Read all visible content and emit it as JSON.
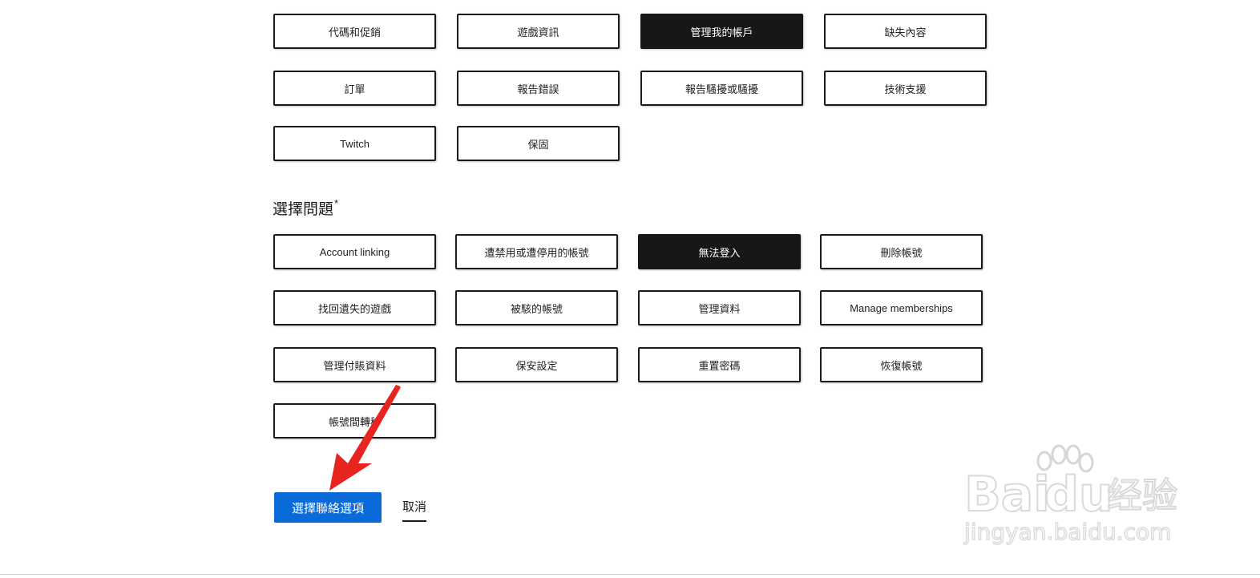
{
  "categories": {
    "items": [
      {
        "label": "代碼和促銷",
        "selected": false
      },
      {
        "label": "遊戲資訊",
        "selected": false
      },
      {
        "label": "管理我的帳戶",
        "selected": true
      },
      {
        "label": "缺失內容",
        "selected": false
      },
      {
        "label": "訂單",
        "selected": false
      },
      {
        "label": "報告錯誤",
        "selected": false
      },
      {
        "label": "報告騷擾或騷擾",
        "selected": false
      },
      {
        "label": "技術支援",
        "selected": false
      },
      {
        "label": "Twitch",
        "selected": false
      },
      {
        "label": "保固",
        "selected": false
      }
    ]
  },
  "issue_section": {
    "title": "選擇問題",
    "required_mark": "*",
    "items": [
      {
        "label": "Account linking",
        "selected": false
      },
      {
        "label": "遭禁用或遭停用的帳號",
        "selected": false
      },
      {
        "label": "無法登入",
        "selected": true
      },
      {
        "label": "刪除帳號",
        "selected": false
      },
      {
        "label": "找回遺失的遊戲",
        "selected": false
      },
      {
        "label": "被駭的帳號",
        "selected": false
      },
      {
        "label": "管理資料",
        "selected": false
      },
      {
        "label": "Manage memberships",
        "selected": false
      },
      {
        "label": "管理付賬資料",
        "selected": false
      },
      {
        "label": "保安設定",
        "selected": false
      },
      {
        "label": "重置密碼",
        "selected": false
      },
      {
        "label": "恢復帳號",
        "selected": false
      },
      {
        "label": "帳號間轉移",
        "selected": false
      }
    ]
  },
  "actions": {
    "primary_label": "選擇聯絡選項",
    "cancel_label": "取消"
  },
  "colors": {
    "selected_bg": "#171717",
    "primary_button": "#0a6ad8",
    "annotation_arrow": "#e8241f"
  },
  "watermark": {
    "brand": "Baidu",
    "brand_cn": "经验",
    "url": "jingyan.baidu.com"
  }
}
